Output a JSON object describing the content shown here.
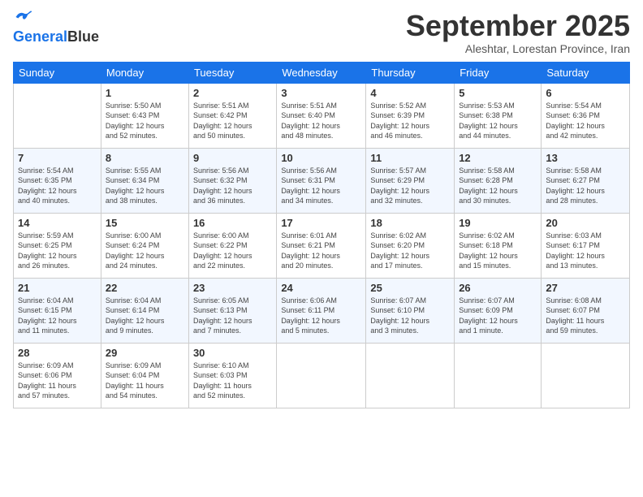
{
  "header": {
    "logo_line1": "General",
    "logo_line2": "Blue",
    "month": "September 2025",
    "location": "Aleshtar, Lorestan Province, Iran"
  },
  "weekdays": [
    "Sunday",
    "Monday",
    "Tuesday",
    "Wednesday",
    "Thursday",
    "Friday",
    "Saturday"
  ],
  "weeks": [
    [
      {
        "day": "",
        "info": ""
      },
      {
        "day": "1",
        "info": "Sunrise: 5:50 AM\nSunset: 6:43 PM\nDaylight: 12 hours\nand 52 minutes."
      },
      {
        "day": "2",
        "info": "Sunrise: 5:51 AM\nSunset: 6:42 PM\nDaylight: 12 hours\nand 50 minutes."
      },
      {
        "day": "3",
        "info": "Sunrise: 5:51 AM\nSunset: 6:40 PM\nDaylight: 12 hours\nand 48 minutes."
      },
      {
        "day": "4",
        "info": "Sunrise: 5:52 AM\nSunset: 6:39 PM\nDaylight: 12 hours\nand 46 minutes."
      },
      {
        "day": "5",
        "info": "Sunrise: 5:53 AM\nSunset: 6:38 PM\nDaylight: 12 hours\nand 44 minutes."
      },
      {
        "day": "6",
        "info": "Sunrise: 5:54 AM\nSunset: 6:36 PM\nDaylight: 12 hours\nand 42 minutes."
      }
    ],
    [
      {
        "day": "7",
        "info": "Sunrise: 5:54 AM\nSunset: 6:35 PM\nDaylight: 12 hours\nand 40 minutes."
      },
      {
        "day": "8",
        "info": "Sunrise: 5:55 AM\nSunset: 6:34 PM\nDaylight: 12 hours\nand 38 minutes."
      },
      {
        "day": "9",
        "info": "Sunrise: 5:56 AM\nSunset: 6:32 PM\nDaylight: 12 hours\nand 36 minutes."
      },
      {
        "day": "10",
        "info": "Sunrise: 5:56 AM\nSunset: 6:31 PM\nDaylight: 12 hours\nand 34 minutes."
      },
      {
        "day": "11",
        "info": "Sunrise: 5:57 AM\nSunset: 6:29 PM\nDaylight: 12 hours\nand 32 minutes."
      },
      {
        "day": "12",
        "info": "Sunrise: 5:58 AM\nSunset: 6:28 PM\nDaylight: 12 hours\nand 30 minutes."
      },
      {
        "day": "13",
        "info": "Sunrise: 5:58 AM\nSunset: 6:27 PM\nDaylight: 12 hours\nand 28 minutes."
      }
    ],
    [
      {
        "day": "14",
        "info": "Sunrise: 5:59 AM\nSunset: 6:25 PM\nDaylight: 12 hours\nand 26 minutes."
      },
      {
        "day": "15",
        "info": "Sunrise: 6:00 AM\nSunset: 6:24 PM\nDaylight: 12 hours\nand 24 minutes."
      },
      {
        "day": "16",
        "info": "Sunrise: 6:00 AM\nSunset: 6:22 PM\nDaylight: 12 hours\nand 22 minutes."
      },
      {
        "day": "17",
        "info": "Sunrise: 6:01 AM\nSunset: 6:21 PM\nDaylight: 12 hours\nand 20 minutes."
      },
      {
        "day": "18",
        "info": "Sunrise: 6:02 AM\nSunset: 6:20 PM\nDaylight: 12 hours\nand 17 minutes."
      },
      {
        "day": "19",
        "info": "Sunrise: 6:02 AM\nSunset: 6:18 PM\nDaylight: 12 hours\nand 15 minutes."
      },
      {
        "day": "20",
        "info": "Sunrise: 6:03 AM\nSunset: 6:17 PM\nDaylight: 12 hours\nand 13 minutes."
      }
    ],
    [
      {
        "day": "21",
        "info": "Sunrise: 6:04 AM\nSunset: 6:15 PM\nDaylight: 12 hours\nand 11 minutes."
      },
      {
        "day": "22",
        "info": "Sunrise: 6:04 AM\nSunset: 6:14 PM\nDaylight: 12 hours\nand 9 minutes."
      },
      {
        "day": "23",
        "info": "Sunrise: 6:05 AM\nSunset: 6:13 PM\nDaylight: 12 hours\nand 7 minutes."
      },
      {
        "day": "24",
        "info": "Sunrise: 6:06 AM\nSunset: 6:11 PM\nDaylight: 12 hours\nand 5 minutes."
      },
      {
        "day": "25",
        "info": "Sunrise: 6:07 AM\nSunset: 6:10 PM\nDaylight: 12 hours\nand 3 minutes."
      },
      {
        "day": "26",
        "info": "Sunrise: 6:07 AM\nSunset: 6:09 PM\nDaylight: 12 hours\nand 1 minute."
      },
      {
        "day": "27",
        "info": "Sunrise: 6:08 AM\nSunset: 6:07 PM\nDaylight: 11 hours\nand 59 minutes."
      }
    ],
    [
      {
        "day": "28",
        "info": "Sunrise: 6:09 AM\nSunset: 6:06 PM\nDaylight: 11 hours\nand 57 minutes."
      },
      {
        "day": "29",
        "info": "Sunrise: 6:09 AM\nSunset: 6:04 PM\nDaylight: 11 hours\nand 54 minutes."
      },
      {
        "day": "30",
        "info": "Sunrise: 6:10 AM\nSunset: 6:03 PM\nDaylight: 11 hours\nand 52 minutes."
      },
      {
        "day": "",
        "info": ""
      },
      {
        "day": "",
        "info": ""
      },
      {
        "day": "",
        "info": ""
      },
      {
        "day": "",
        "info": ""
      }
    ]
  ]
}
